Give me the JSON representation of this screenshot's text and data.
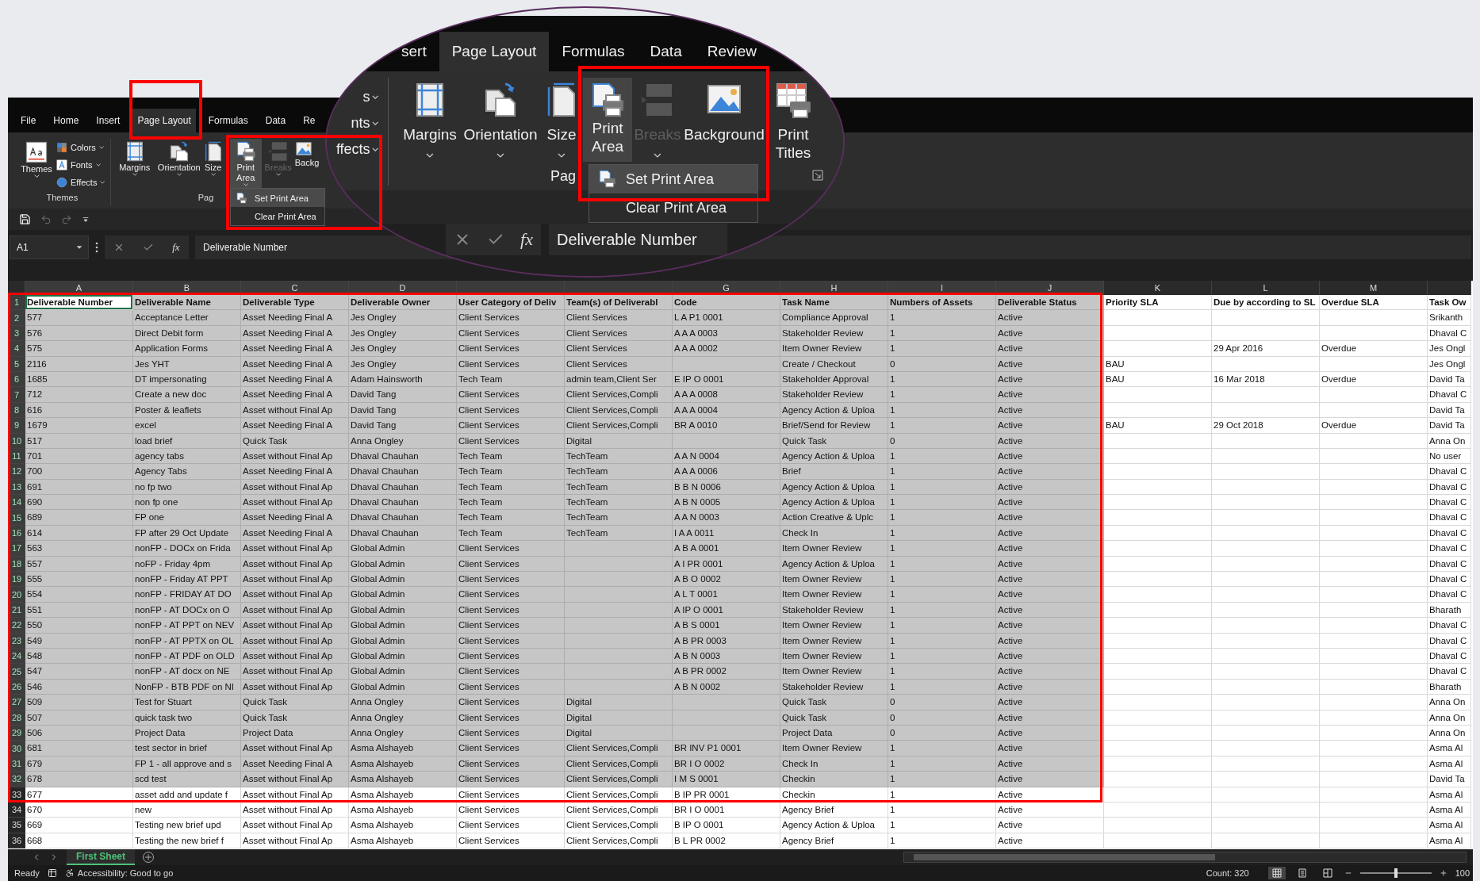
{
  "tabs": [
    {
      "label": "File",
      "selected": false
    },
    {
      "label": "Home",
      "selected": false
    },
    {
      "label": "Insert",
      "selected": false
    },
    {
      "label": "Page Layout",
      "selected": true
    },
    {
      "label": "Formulas",
      "selected": false
    },
    {
      "label": "Data",
      "selected": false
    },
    {
      "label": "Re",
      "selected": false
    }
  ],
  "ribbon": {
    "themes_group": {
      "label": "Themes",
      "button": "Themes",
      "options": [
        "Colors",
        "Fonts",
        "Effects"
      ]
    },
    "page_setup_group": {
      "label": "Pag",
      "buttons": [
        {
          "lines": [
            "Margins"
          ],
          "selected": false,
          "disabled": false
        },
        {
          "lines": [
            "Orientation"
          ],
          "selected": false,
          "disabled": false
        },
        {
          "lines": [
            "Size"
          ],
          "selected": false,
          "disabled": false
        },
        {
          "lines": [
            "Print",
            "Area"
          ],
          "selected": true,
          "disabled": false
        },
        {
          "lines": [
            "Breaks"
          ],
          "selected": false,
          "disabled": true
        },
        {
          "lines": [
            "Backg"
          ],
          "selected": false,
          "disabled": false
        }
      ]
    },
    "menu": [
      {
        "label": "Set Print Area",
        "selected": true
      },
      {
        "label": "Clear Print Area",
        "selected": false
      }
    ]
  },
  "formula_bar": {
    "name_box": "A1",
    "function_label": "fx",
    "formula": "Deliverable Number"
  },
  "magnifier": {
    "tabs": [
      {
        "label": "sert",
        "selected": false
      },
      {
        "label": "Page Layout",
        "selected": true
      },
      {
        "label": "Formulas",
        "selected": false
      },
      {
        "label": "Data",
        "selected": false
      },
      {
        "label": "Review",
        "selected": false
      }
    ],
    "options": [
      "s",
      "nts",
      "ffects"
    ],
    "buttons": [
      {
        "lines": [
          "Margins"
        ],
        "selected": false,
        "disabled": false
      },
      {
        "lines": [
          "Orientation"
        ],
        "selected": false,
        "disabled": false
      },
      {
        "lines": [
          "Size"
        ],
        "selected": false,
        "disabled": false
      },
      {
        "lines": [
          "Print",
          "Area"
        ],
        "selected": true,
        "disabled": false
      },
      {
        "lines": [
          "Breaks"
        ],
        "selected": false,
        "disabled": true
      },
      {
        "lines": [
          "Background"
        ],
        "selected": false,
        "disabled": false
      },
      {
        "lines": [
          "Print",
          "Titles"
        ],
        "selected": false,
        "disabled": false
      }
    ],
    "group_label": "Pag",
    "menu": [
      {
        "label": "Set Print Area",
        "selected": true
      },
      {
        "label": "Clear Print Area",
        "selected": false
      }
    ],
    "function_label": "fx",
    "formula": "Deliverable Number"
  },
  "grid": {
    "columns": [
      {
        "letter": "A",
        "selected": true
      },
      {
        "letter": "B",
        "selected": true
      },
      {
        "letter": "C",
        "selected": true
      },
      {
        "letter": "D",
        "selected": true
      },
      {
        "selected": true
      },
      {
        "selected": true
      },
      {
        "letter": "G",
        "selected": true
      },
      {
        "letter": "H",
        "selected": true
      },
      {
        "letter": "I",
        "selected": true
      },
      {
        "letter": "J",
        "selected": true
      },
      {
        "letter": "K",
        "selected": false
      },
      {
        "letter": "L",
        "selected": false
      },
      {
        "letter": "M",
        "selected": false
      },
      {
        "selected": false
      }
    ],
    "header": {
      "num": "1",
      "selected": true,
      "cells": [
        {
          "text": "Deliverable Number",
          "active": true
        },
        {
          "text": "Deliverable Name",
          "active": false
        },
        {
          "text": "Deliverable Type",
          "active": false
        },
        {
          "text": "Deliverable Owner",
          "active": false
        },
        {
          "text": "User Category of Deliv",
          "active": false
        },
        {
          "text": "Team(s) of Deliverabl",
          "active": false
        },
        {
          "text": "Code",
          "active": false
        },
        {
          "text": "Task Name",
          "active": false
        },
        {
          "text": "Numbers of Assets",
          "active": false
        },
        {
          "text": "Deliverable Status",
          "active": false
        },
        {
          "text": "Priority SLA",
          "active": false
        },
        {
          "text": "Due by according to SL",
          "active": false
        },
        {
          "text": "Overdue SLA",
          "active": false
        },
        {
          "text": "Task Ow",
          "active": false
        }
      ]
    },
    "rows": [
      {
        "num": "2",
        "selected": true,
        "cells": [
          "577",
          "Acceptance Letter",
          "Asset Needing Final A",
          "Jes Ongley",
          "Client Services",
          "Client Services",
          "L A P1 0001",
          "Compliance Approval",
          "1",
          "Active",
          null,
          null,
          null,
          "Srikanth"
        ]
      },
      {
        "num": "3",
        "selected": true,
        "cells": [
          "576",
          "Direct Debit form",
          "Asset Needing Final A",
          "Jes Ongley",
          "Client Services",
          "Client Services",
          "A A A 0003",
          "Stakeholder Review",
          "1",
          "Active",
          null,
          null,
          null,
          "Dhaval C"
        ]
      },
      {
        "num": "4",
        "selected": true,
        "cells": [
          "575",
          "Application Forms",
          "Asset Needing Final A",
          "Jes Ongley",
          "Client Services",
          "Client Services",
          "A A A 0002",
          "Item Owner Review",
          "1",
          "Active",
          null,
          "29 Apr 2016",
          "Overdue",
          "Jes Ongl"
        ]
      },
      {
        "num": "5",
        "selected": true,
        "cells": [
          "2116",
          "Jes YHT",
          "Asset Needing Final A",
          "Jes Ongley",
          "Client Services",
          "Client Services",
          null,
          "Create / Checkout",
          "0",
          "Active",
          "BAU",
          null,
          null,
          "Jes Ongl"
        ]
      },
      {
        "num": "6",
        "selected": true,
        "cells": [
          "1685",
          "DT impersonating",
          "Asset Needing Final A",
          "Adam Hainsworth",
          "Tech Team",
          "admin team,Client Ser",
          "E IP O 0001",
          "Stakeholder Approval",
          "1",
          "Active",
          "BAU",
          "16 Mar 2018",
          "Overdue",
          "David Ta"
        ]
      },
      {
        "num": "7",
        "selected": true,
        "cells": [
          "712",
          "Create a new doc",
          "Asset Needing Final A",
          "David Tang",
          "Client Services",
          "Client Services,Compli",
          "A A A 0008",
          "Stakeholder Review",
          "1",
          "Active",
          null,
          null,
          null,
          "Dhaval C"
        ]
      },
      {
        "num": "8",
        "selected": true,
        "cells": [
          "616",
          "Poster & leaflets",
          "Asset without Final Ap",
          "David Tang",
          "Client Services",
          "Client Services,Compli",
          "A A A 0004",
          "Agency Action & Uploa",
          "1",
          "Active",
          null,
          null,
          null,
          "David Ta"
        ]
      },
      {
        "num": "9",
        "selected": true,
        "cells": [
          "1679",
          "excel",
          "Asset Needing Final A",
          "David Tang",
          "Client Services",
          "Client Services,Compli",
          "BR A 0010",
          "Brief/Send for Review",
          "1",
          "Active",
          "BAU",
          "29 Oct 2018",
          "Overdue",
          "David Ta"
        ]
      },
      {
        "num": "10",
        "selected": true,
        "cells": [
          "517",
          "load brief",
          "Quick Task",
          "Anna Ongley",
          "Client Services",
          "Digital",
          null,
          "Quick Task",
          "0",
          "Active",
          null,
          null,
          null,
          "Anna On"
        ]
      },
      {
        "num": "11",
        "selected": true,
        "cells": [
          "701",
          "agency tabs",
          "Asset without Final Ap",
          "Dhaval Chauhan",
          "Tech Team",
          "TechTeam",
          "A A N 0004",
          "Agency Action & Uploa",
          "1",
          "Active",
          null,
          null,
          null,
          "No user"
        ]
      },
      {
        "num": "12",
        "selected": true,
        "cells": [
          "700",
          "Agency Tabs",
          "Asset Needing Final A",
          "Dhaval Chauhan",
          "Tech Team",
          "TechTeam",
          "A A A 0006",
          "Brief",
          "1",
          "Active",
          null,
          null,
          null,
          "Dhaval C"
        ]
      },
      {
        "num": "13",
        "selected": true,
        "cells": [
          "691",
          "no fp two",
          "Asset without Final Ap",
          "Dhaval Chauhan",
          "Tech Team",
          "TechTeam",
          "B B N 0006",
          "Agency Action & Uploa",
          "1",
          "Active",
          null,
          null,
          null,
          "Dhaval C"
        ]
      },
      {
        "num": "14",
        "selected": true,
        "cells": [
          "690",
          "non fp one",
          "Asset without Final Ap",
          "Dhaval Chauhan",
          "Tech Team",
          "TechTeam",
          "A B N 0005",
          "Agency Action & Uploa",
          "1",
          "Active",
          null,
          null,
          null,
          "Dhaval C"
        ]
      },
      {
        "num": "15",
        "selected": true,
        "cells": [
          "689",
          "FP one",
          "Asset Needing Final A",
          "Dhaval Chauhan",
          "Tech Team",
          "TechTeam",
          "A A N 0003",
          "Action Creative & Uplc",
          "1",
          "Active",
          null,
          null,
          null,
          "Dhaval C"
        ]
      },
      {
        "num": "16",
        "selected": true,
        "cells": [
          "614",
          "FP after 29 Oct Update",
          "Asset Needing Final A",
          "Dhaval Chauhan",
          "Tech Team",
          "TechTeam",
          "I A A 0011",
          "Check In",
          "1",
          "Active",
          null,
          null,
          null,
          "Dhaval C"
        ]
      },
      {
        "num": "17",
        "selected": true,
        "cells": [
          "563",
          "nonFP - DOCx on Frida",
          "Asset without Final Ap",
          "Global Admin",
          "Client Services",
          null,
          "A B A 0001",
          "Item Owner Review",
          "1",
          "Active",
          null,
          null,
          null,
          "Dhaval C"
        ]
      },
      {
        "num": "18",
        "selected": true,
        "cells": [
          "557",
          "noFP - Friday 4pm",
          "Asset without Final Ap",
          "Global Admin",
          "Client Services",
          null,
          "A I PR 0001",
          "Agency Action & Uploa",
          "1",
          "Active",
          null,
          null,
          null,
          "Dhaval C"
        ]
      },
      {
        "num": "19",
        "selected": true,
        "cells": [
          "555",
          "nonFP - Friday AT PPT",
          "Asset without Final Ap",
          "Global Admin",
          "Client Services",
          null,
          "A B O 0002",
          "Item Owner Review",
          "1",
          "Active",
          null,
          null,
          null,
          "Dhaval C"
        ]
      },
      {
        "num": "20",
        "selected": true,
        "cells": [
          "554",
          "nonFP - FRIDAY AT DO",
          "Asset without Final Ap",
          "Global Admin",
          "Client Services",
          null,
          "A L T 0001",
          "Item Owner Review",
          "1",
          "Active",
          null,
          null,
          null,
          "Dhaval C"
        ]
      },
      {
        "num": "21",
        "selected": true,
        "cells": [
          "551",
          "nonFP - AT DOCx on O",
          "Asset without Final Ap",
          "Global Admin",
          "Client Services",
          null,
          "A IP O 0001",
          "Stakeholder Review",
          "1",
          "Active",
          null,
          null,
          null,
          "Bharath"
        ]
      },
      {
        "num": "22",
        "selected": true,
        "cells": [
          "550",
          "nonFP - AT PPT on NEV",
          "Asset without Final Ap",
          "Global Admin",
          "Client Services",
          null,
          "A B S 0001",
          "Item Owner Review",
          "1",
          "Active",
          null,
          null,
          null,
          "Dhaval C"
        ]
      },
      {
        "num": "23",
        "selected": true,
        "cells": [
          "549",
          "nonFP - AT PPTX on OL",
          "Asset without Final Ap",
          "Global Admin",
          "Client Services",
          null,
          "A B PR 0003",
          "Item Owner Review",
          "1",
          "Active",
          null,
          null,
          null,
          "Dhaval C"
        ]
      },
      {
        "num": "24",
        "selected": true,
        "cells": [
          "548",
          "nonFP - AT PDF on OLD",
          "Asset without Final Ap",
          "Global Admin",
          "Client Services",
          null,
          "A B N 0003",
          "Item Owner Review",
          "1",
          "Active",
          null,
          null,
          null,
          "Dhaval C"
        ]
      },
      {
        "num": "25",
        "selected": true,
        "cells": [
          "547",
          "nonFP - AT docx on NE",
          "Asset without Final Ap",
          "Global Admin",
          "Client Services",
          null,
          "A B PR 0002",
          "Item Owner Review",
          "1",
          "Active",
          null,
          null,
          null,
          "Dhaval C"
        ]
      },
      {
        "num": "26",
        "selected": true,
        "cells": [
          "546",
          "NonFP - BTB PDF on NI",
          "Asset without Final Ap",
          "Global Admin",
          "Client Services",
          null,
          "A B N 0002",
          "Stakeholder Review",
          "1",
          "Active",
          null,
          null,
          null,
          "Bharath"
        ]
      },
      {
        "num": "27",
        "selected": true,
        "cells": [
          "509",
          "Test for Stuart",
          "Quick Task",
          "Anna Ongley",
          "Client Services",
          "Digital",
          null,
          "Quick Task",
          "0",
          "Active",
          null,
          null,
          null,
          "Anna On"
        ]
      },
      {
        "num": "28",
        "selected": true,
        "cells": [
          "507",
          "quick task two",
          "Quick Task",
          "Anna Ongley",
          "Client Services",
          "Digital",
          null,
          "Quick Task",
          "0",
          "Active",
          null,
          null,
          null,
          "Anna On"
        ]
      },
      {
        "num": "29",
        "selected": true,
        "cells": [
          "506",
          "Project Data",
          "Project Data",
          "Anna Ongley",
          "Client Services",
          "Digital",
          null,
          "Project Data",
          "0",
          "Active",
          null,
          null,
          null,
          "Anna On"
        ]
      },
      {
        "num": "30",
        "selected": true,
        "cells": [
          "681",
          "test sector in brief",
          "Asset without Final Ap",
          "Asma Alshayeb",
          "Client Services",
          "Client Services,Compli",
          "BR INV P1 0001",
          "Item Owner Review",
          "1",
          "Active",
          null,
          null,
          null,
          "Asma Al"
        ]
      },
      {
        "num": "31",
        "selected": true,
        "cells": [
          "679",
          "FP 1 - all approve and s",
          "Asset Needing Final A",
          "Asma Alshayeb",
          "Client Services",
          "Client Services,Compli",
          "BR I O 0002",
          "Check In",
          "1",
          "Active",
          null,
          null,
          null,
          "Asma Al"
        ]
      },
      {
        "num": "32",
        "selected": true,
        "cells": [
          "678",
          "scd test",
          "Asset without Final Ap",
          "Asma Alshayeb",
          "Client Services",
          "Client Services,Compli",
          "I M S 0001",
          "Checkin",
          "1",
          "Active",
          null,
          null,
          null,
          "David Ta"
        ]
      },
      {
        "num": "33",
        "selected": false,
        "cells": [
          "677",
          "asset add and update f",
          "Asset without Final Ap",
          "Asma Alshayeb",
          "Client Services",
          "Client Services,Compli",
          "B IP PR 0001",
          "Checkin",
          "1",
          "Active",
          null,
          null,
          null,
          "Asma Al"
        ]
      },
      {
        "num": "34",
        "selected": false,
        "cells": [
          "670",
          "new",
          "Asset without Final Ap",
          "Asma Alshayeb",
          "Client Services",
          "Client Services,Compli",
          "BR I O 0001",
          "Agency Brief",
          "1",
          "Active",
          null,
          null,
          null,
          "Asma Al"
        ]
      },
      {
        "num": "35",
        "selected": false,
        "cells": [
          "669",
          "Testing new brief upd",
          "Asset without Final Ap",
          "Asma Alshayeb",
          "Client Services",
          "Client Services,Compli",
          "B IP O 0001",
          "Agency Action & Uploa",
          "1",
          "Active",
          null,
          null,
          null,
          "Asma Al"
        ]
      },
      {
        "num": "36",
        "selected": false,
        "cells": [
          "668",
          "Testing the new brief f",
          "Asset without Final Ap",
          "Asma Alshayeb",
          "Client Services",
          "Client Services,Compli",
          "B L PR 0002",
          "Agency Brief",
          "1",
          "Active",
          null,
          null,
          null,
          "Asma Al"
        ]
      }
    ]
  },
  "sheet_tabs": [
    {
      "label": "First Sheet",
      "selected": true
    }
  ],
  "status_bar": {
    "mode": "Ready",
    "accessibility": "Accessibility: Good to go",
    "count": "Count: 320",
    "views": [
      {
        "selected": true
      },
      {
        "selected": false
      },
      {
        "selected": false
      }
    ],
    "zoom_slider": {
      "level": 0.5
    },
    "zoom": "100"
  }
}
